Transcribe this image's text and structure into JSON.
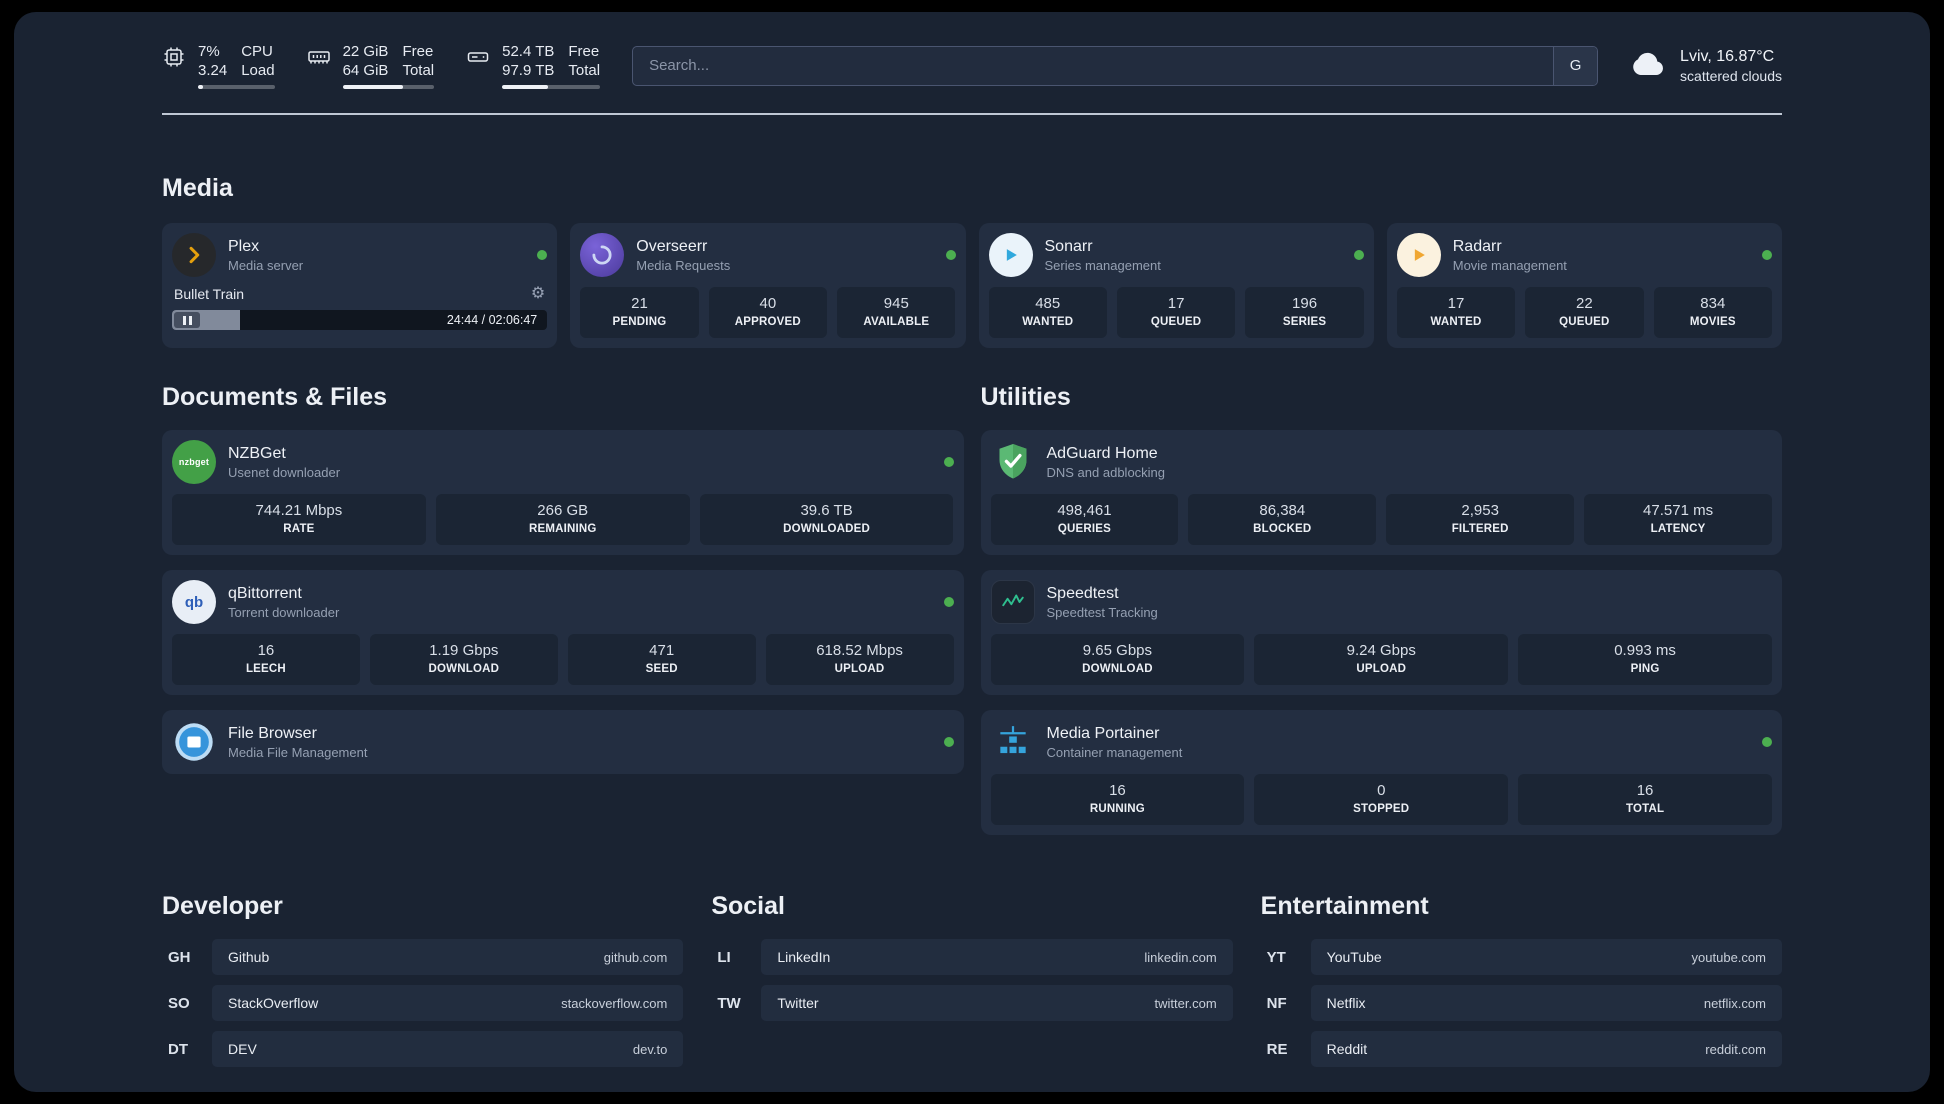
{
  "header": {
    "cpu": {
      "value1": "7%",
      "value2": "3.24",
      "label1": "CPU",
      "label2": "Load"
    },
    "ram": {
      "value1": "22 GiB",
      "value2": "64 GiB",
      "label1": "Free",
      "label2": "Total"
    },
    "disk": {
      "value1": "52.4 TB",
      "value2": "97.9 TB",
      "label1": "Free",
      "label2": "Total"
    },
    "search": {
      "placeholder": "Search...",
      "engine_label": "G"
    },
    "weather": {
      "location": "Lviv, 16.87°C",
      "condition": "scattered clouds"
    }
  },
  "icons": {
    "gear": "⚙"
  },
  "colors": {
    "status_online": "#4caf50",
    "plex_accent": "#e5a00d",
    "speedtest_accent": "#2fbf8f"
  },
  "sections": {
    "media": {
      "title": "Media"
    },
    "documents": {
      "title": "Documents & Files"
    },
    "utilities": {
      "title": "Utilities"
    },
    "developer": {
      "title": "Developer"
    },
    "social": {
      "title": "Social"
    },
    "entertainment": {
      "title": "Entertainment"
    }
  },
  "apps": {
    "plex": {
      "name": "Plex",
      "subtitle": "Media server",
      "now_playing": "Bullet Train",
      "time": "24:44 / 02:06:47"
    },
    "overseerr": {
      "name": "Overseerr",
      "subtitle": "Media Requests",
      "stats": [
        {
          "value": "21",
          "label": "PENDING"
        },
        {
          "value": "40",
          "label": "APPROVED"
        },
        {
          "value": "945",
          "label": "AVAILABLE"
        }
      ]
    },
    "sonarr": {
      "name": "Sonarr",
      "subtitle": "Series management",
      "stats": [
        {
          "value": "485",
          "label": "WANTED"
        },
        {
          "value": "17",
          "label": "QUEUED"
        },
        {
          "value": "196",
          "label": "SERIES"
        }
      ]
    },
    "radarr": {
      "name": "Radarr",
      "subtitle": "Movie management",
      "stats": [
        {
          "value": "17",
          "label": "WANTED"
        },
        {
          "value": "22",
          "label": "QUEUED"
        },
        {
          "value": "834",
          "label": "MOVIES"
        }
      ]
    },
    "nzbget": {
      "name": "NZBGet",
      "subtitle": "Usenet downloader",
      "icon_text": "nzbget",
      "stats": [
        {
          "value": "744.21 Mbps",
          "label": "RATE"
        },
        {
          "value": "266 GB",
          "label": "REMAINING"
        },
        {
          "value": "39.6 TB",
          "label": "DOWNLOADED"
        }
      ]
    },
    "qbittorrent": {
      "name": "qBittorrent",
      "subtitle": "Torrent downloader",
      "icon_text": "qb",
      "stats": [
        {
          "value": "16",
          "label": "LEECH"
        },
        {
          "value": "1.19 Gbps",
          "label": "DOWNLOAD"
        },
        {
          "value": "471",
          "label": "SEED"
        },
        {
          "value": "618.52 Mbps",
          "label": "UPLOAD"
        }
      ]
    },
    "filebrowser": {
      "name": "File Browser",
      "subtitle": "Media File Management"
    },
    "adguard": {
      "name": "AdGuard Home",
      "subtitle": "DNS and adblocking",
      "stats": [
        {
          "value": "498,461",
          "label": "QUERIES"
        },
        {
          "value": "86,384",
          "label": "BLOCKED"
        },
        {
          "value": "2,953",
          "label": "FILTERED"
        },
        {
          "value": "47.571 ms",
          "label": "LATENCY"
        }
      ]
    },
    "speedtest": {
      "name": "Speedtest",
      "subtitle": "Speedtest Tracking",
      "stats": [
        {
          "value": "9.65 Gbps",
          "label": "DOWNLOAD"
        },
        {
          "value": "9.24 Gbps",
          "label": "UPLOAD"
        },
        {
          "value": "0.993 ms",
          "label": "PING"
        }
      ]
    },
    "portainer": {
      "name": "Media Portainer",
      "subtitle": "Container management",
      "stats": [
        {
          "value": "16",
          "label": "RUNNING"
        },
        {
          "value": "0",
          "label": "STOPPED"
        },
        {
          "value": "16",
          "label": "TOTAL"
        }
      ]
    }
  },
  "bookmarks": {
    "developer": [
      {
        "abbr": "GH",
        "name": "Github",
        "domain": "github.com"
      },
      {
        "abbr": "SO",
        "name": "StackOverflow",
        "domain": "stackoverflow.com"
      },
      {
        "abbr": "DT",
        "name": "DEV",
        "domain": "dev.to"
      }
    ],
    "social": [
      {
        "abbr": "LI",
        "name": "LinkedIn",
        "domain": "linkedin.com"
      },
      {
        "abbr": "TW",
        "name": "Twitter",
        "domain": "twitter.com"
      }
    ],
    "entertainment": [
      {
        "abbr": "YT",
        "name": "YouTube",
        "domain": "youtube.com"
      },
      {
        "abbr": "NF",
        "name": "Netflix",
        "domain": "netflix.com"
      },
      {
        "abbr": "RE",
        "name": "Reddit",
        "domain": "reddit.com"
      }
    ]
  }
}
